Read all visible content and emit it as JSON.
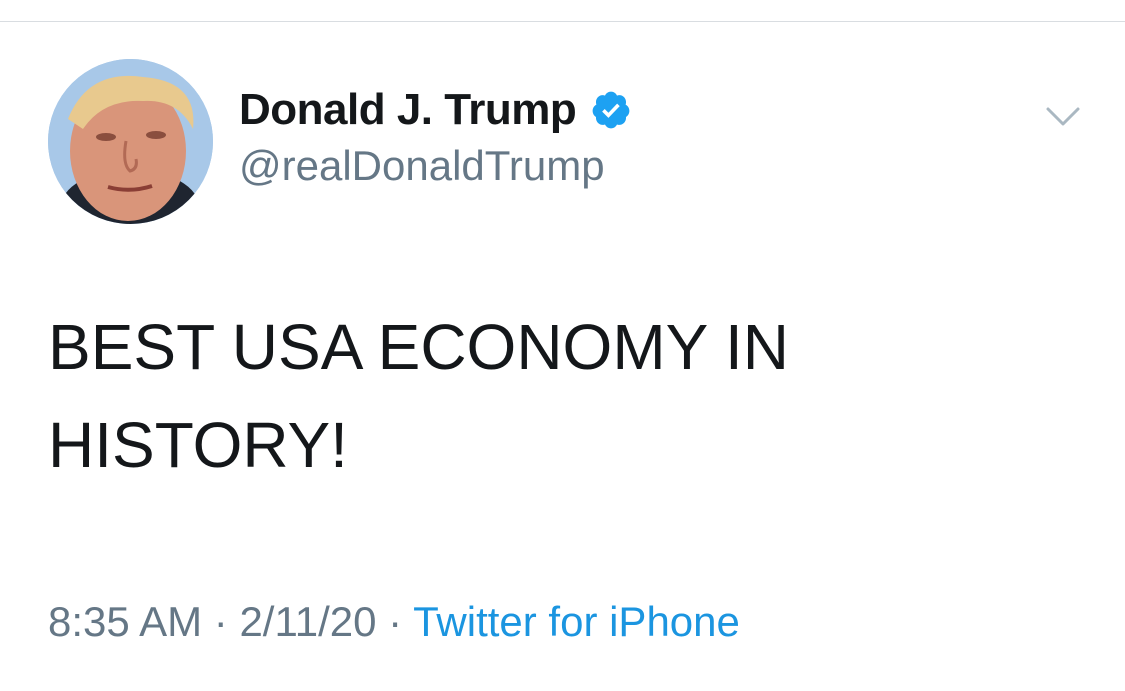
{
  "tweet": {
    "display_name": "Donald J. Trump",
    "handle": "@realDonaldTrump",
    "verified": true,
    "text_line1": "BEST USA ECONOMY IN",
    "text_line2": "HISTORY!",
    "time": "8:35 AM",
    "date": "2/11/20",
    "source": "Twitter for iPhone",
    "separator": "·"
  },
  "icons": {
    "verified": "verified-badge-icon",
    "more": "chevron-down-icon"
  },
  "colors": {
    "primary_text": "#14171a",
    "secondary_text": "#657786",
    "link": "#1b95e0",
    "verified": "#1da1f2"
  }
}
